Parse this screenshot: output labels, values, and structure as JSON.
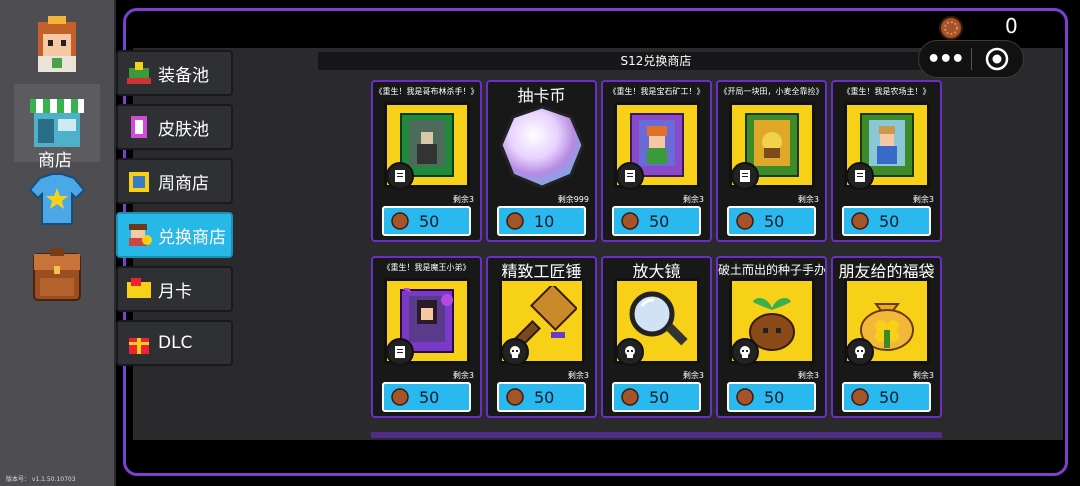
{
  "colors": {
    "accent": "#7b3fd1",
    "price_bg": "#2ab9ef",
    "active_tab": "#28b8e8",
    "frame_yellow": "#f7d018"
  },
  "rail": {
    "items": [
      {
        "name": "avatar",
        "icon": "player-avatar-icon"
      },
      {
        "name": "shop",
        "icon": "shop-icon",
        "label": "商店"
      },
      {
        "name": "wardrobe",
        "icon": "tshirt-icon"
      },
      {
        "name": "backpack",
        "icon": "backpack-icon"
      }
    ],
    "version": "版本号： v1.1.50.10703"
  },
  "currency": {
    "count": "0",
    "icon": "coin-icon"
  },
  "capsule": {
    "more": "•••",
    "target_icon": "target-icon"
  },
  "tabs": [
    {
      "label": "装备池",
      "icon": "equipment-pool-icon"
    },
    {
      "label": "皮肤池",
      "icon": "skin-pool-icon"
    },
    {
      "label": "周商店",
      "icon": "weekly-shop-icon"
    },
    {
      "label": "兑换商店",
      "icon": "exchange-shop-icon",
      "active": true
    },
    {
      "label": "月卡",
      "icon": "monthly-card-icon"
    },
    {
      "label": "DLC",
      "icon": "dlc-icon"
    }
  ],
  "shop": {
    "title": "S12兑换商店",
    "items": [
      {
        "title": "《重生！我是哥布林杀手！》",
        "size": "small",
        "remain": "剩余3",
        "price": "50",
        "art": "book-goblin-slayer-icon"
      },
      {
        "title": "抽卡币",
        "size": "big",
        "remain": "剩余999",
        "price": "10",
        "art": "gacha-crystal-icon"
      },
      {
        "title": "《重生！我是宝石矿工！》",
        "size": "small",
        "remain": "剩余3",
        "price": "50",
        "art": "book-gem-miner-icon"
      },
      {
        "title": "《开局一块田，小麦全靠捡》",
        "size": "small",
        "remain": "剩余3",
        "price": "50",
        "art": "book-wheat-field-icon"
      },
      {
        "title": "《重生！我是农场主！》",
        "size": "small",
        "remain": "剩余3",
        "price": "50",
        "art": "book-farmer-icon"
      },
      {
        "title": "《重生！我是魔王小弟》",
        "size": "small",
        "remain": "剩余3",
        "price": "50",
        "art": "book-demon-minion-icon"
      },
      {
        "title": "精致工匠锤",
        "size": "big",
        "remain": "剩余3",
        "price": "50",
        "art": "craftsman-hammer-icon"
      },
      {
        "title": "放大镜",
        "size": "big",
        "remain": "剩余3",
        "price": "50",
        "art": "magnifier-icon"
      },
      {
        "title": "破土而出的种子手办",
        "size": "big",
        "remain": "剩余3",
        "price": "50",
        "art": "sprout-figure-icon"
      },
      {
        "title": "朋友给的福袋",
        "size": "big",
        "remain": "剩余3",
        "price": "50",
        "art": "lucky-bag-icon"
      }
    ]
  }
}
